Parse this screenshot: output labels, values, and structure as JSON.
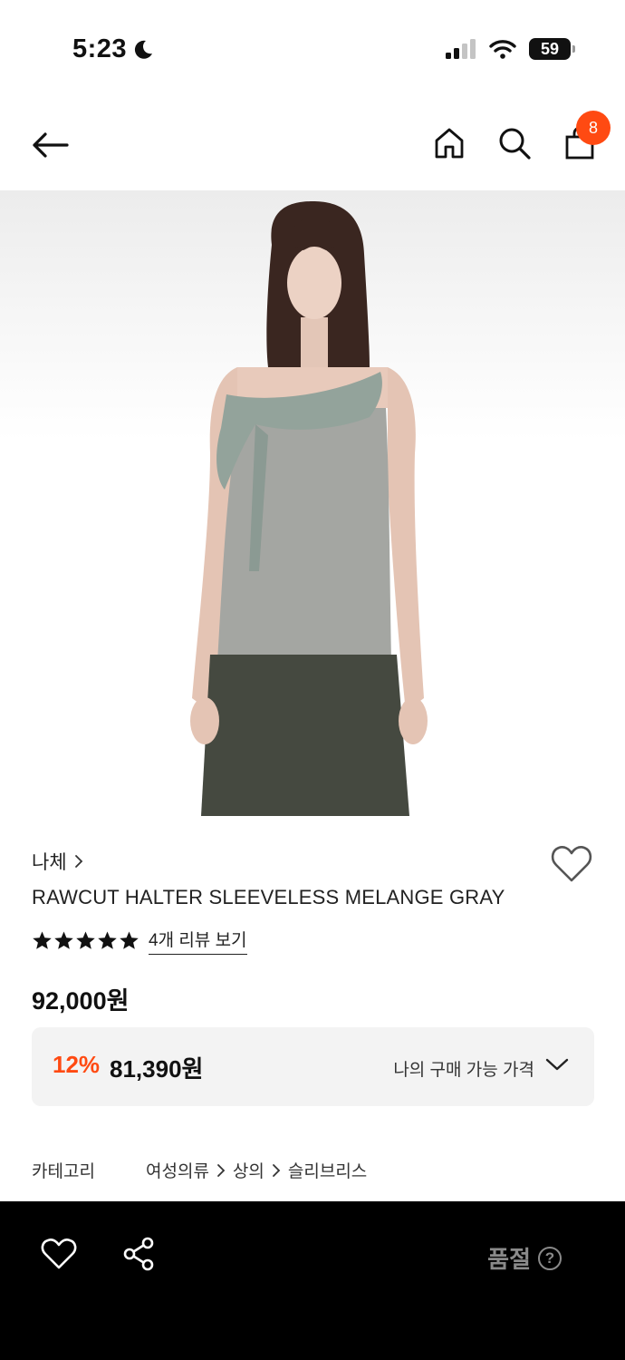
{
  "status_bar": {
    "time": "5:23",
    "battery": "59"
  },
  "nav": {
    "cart_count": "8"
  },
  "product": {
    "brand": "나체",
    "title": "RAWCUT HALTER SLEEVELESS MELANGE GRAY",
    "rating_stars": 5,
    "review_link": "4개 리뷰 보기",
    "original_price": "92,000원",
    "discount_rate": "12%",
    "discount_price": "81,390원",
    "price_label": "나의 구매 가능 가격"
  },
  "category": {
    "label": "카테고리",
    "path": [
      "여성의류",
      "상의",
      "슬리브리스"
    ]
  },
  "bottom_bar": {
    "status_text": "품절",
    "help_icon": "?"
  },
  "icons": {
    "back": "arrow-left-icon",
    "home": "home-icon",
    "search": "search-icon",
    "cart": "shopping-bag-icon",
    "wish": "heart-outline-icon",
    "share": "share-icon",
    "moon": "moon-icon",
    "signal": "signal-icon",
    "wifi": "wifi-icon"
  },
  "colors": {
    "accent": "#ff4a12",
    "text": "#111111",
    "bottom_bar": "#000000",
    "soldout_text": "#8a8a8a"
  }
}
